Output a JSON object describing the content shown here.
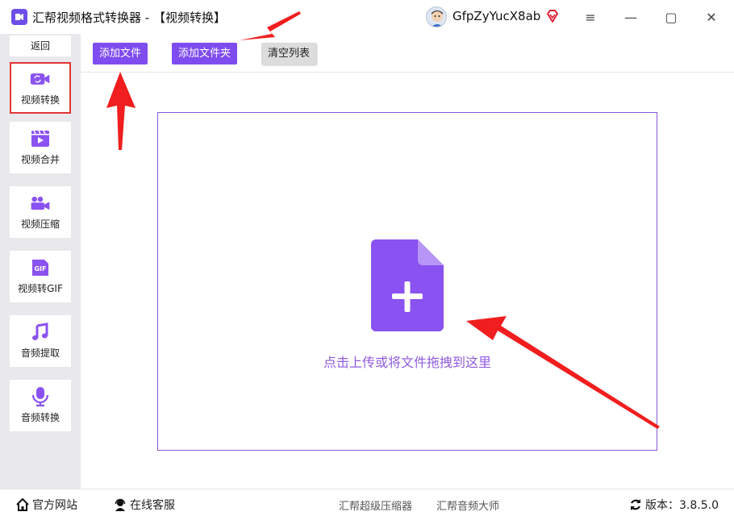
{
  "window": {
    "title": "汇帮视频格式转换器  - 【视频转换】",
    "user_name": "GfpZyYucX8ab",
    "controls": {
      "menu": "≡",
      "minimize": "—",
      "maximize": "▢",
      "close": "✕"
    }
  },
  "sidebar": {
    "back_label": "返回",
    "items": [
      {
        "label": "视频转换",
        "icon": "video-convert-icon",
        "active": true
      },
      {
        "label": "视频合并",
        "icon": "video-merge-icon"
      },
      {
        "label": "视频压缩",
        "icon": "video-compress-icon"
      },
      {
        "label": "视频转GIF",
        "icon": "gif-icon",
        "badge": "GIF"
      },
      {
        "label": "音频提取",
        "icon": "music-note-icon"
      },
      {
        "label": "音频转换",
        "icon": "microphone-icon"
      }
    ]
  },
  "toolbar": {
    "add_file": "添加文件",
    "add_folder": "添加文件夹",
    "clear_list": "清空列表"
  },
  "main": {
    "drop_hint": "点击上传或将文件拖拽到这里"
  },
  "statusbar": {
    "website": "官方网站",
    "support": "在线客服",
    "link1": "汇帮超级压缩器",
    "link2": "汇帮音频大师",
    "version": "版本：3.8.5.0"
  },
  "colors": {
    "accent": "#7f4cf0",
    "hint": "#8f5be0",
    "active_border": "#e23535",
    "annotation": "#f01e1e"
  }
}
